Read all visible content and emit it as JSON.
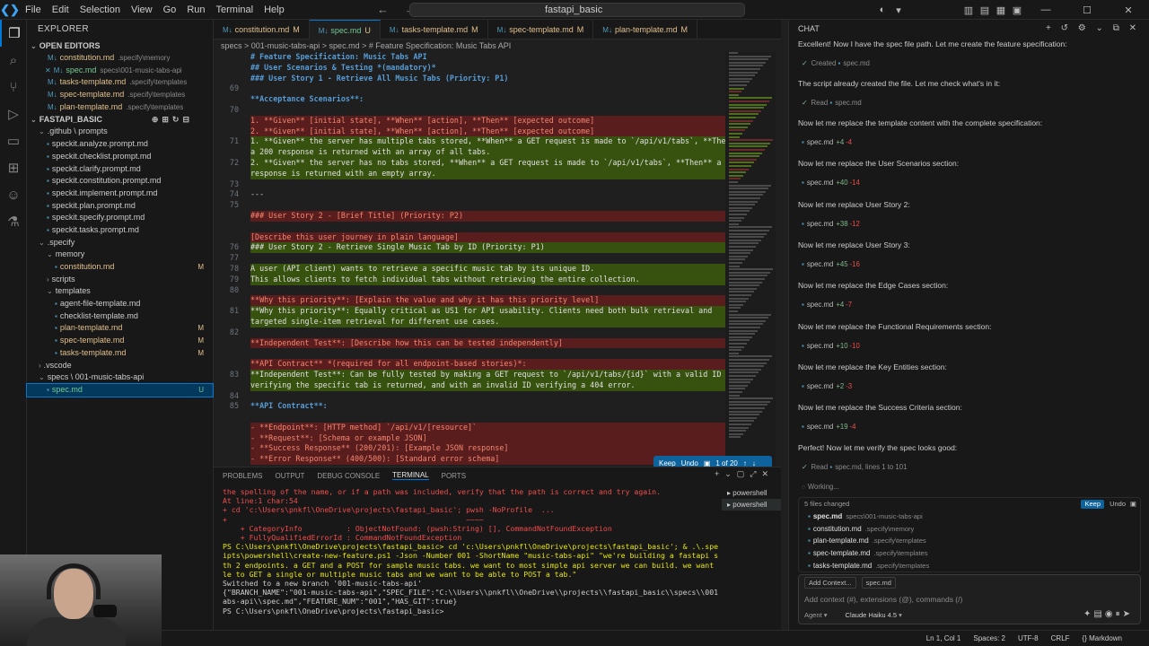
{
  "titlebar": {
    "menus": [
      "File",
      "Edit",
      "Selection",
      "View",
      "Go",
      "Run",
      "Terminal",
      "Help"
    ],
    "search": "fastapi_basic"
  },
  "sidebar": {
    "title": "EXPLORER",
    "open_editors_label": "OPEN EDITORS",
    "open_editors": [
      {
        "name": "constitution.md",
        "path": ".specify\\memory",
        "status": "M"
      },
      {
        "name": "spec.md",
        "path": "specs\\001-music-tabs-api",
        "status": "U",
        "closable": true
      },
      {
        "name": "tasks-template.md",
        "path": ".specify\\templates",
        "status": "M"
      },
      {
        "name": "spec-template.md",
        "path": ".specify\\templates",
        "status": "M"
      },
      {
        "name": "plan-template.md",
        "path": ".specify\\templates",
        "status": "M"
      }
    ],
    "project_label": "FASTAPI_BASIC",
    "tree": [
      {
        "name": ".github \\ prompts",
        "depth": 1,
        "folder": true
      },
      {
        "name": "speckit.analyze.prompt.md",
        "depth": 2
      },
      {
        "name": "speckit.checklist.prompt.md",
        "depth": 2
      },
      {
        "name": "speckit.clarify.prompt.md",
        "depth": 2
      },
      {
        "name": "speckit.constitution.prompt.md",
        "depth": 2
      },
      {
        "name": "speckit.implement.prompt.md",
        "depth": 2
      },
      {
        "name": "speckit.plan.prompt.md",
        "depth": 2
      },
      {
        "name": "speckit.specify.prompt.md",
        "depth": 2
      },
      {
        "name": "speckit.tasks.prompt.md",
        "depth": 2
      },
      {
        "name": ".specify",
        "depth": 1,
        "folder": true
      },
      {
        "name": "memory",
        "depth": 2,
        "folder": true
      },
      {
        "name": "constitution.md",
        "depth": 3,
        "status": "M"
      },
      {
        "name": "scripts",
        "depth": 2,
        "folder": true,
        "collapsed": true
      },
      {
        "name": "templates",
        "depth": 2,
        "folder": true
      },
      {
        "name": "agent-file-template.md",
        "depth": 3
      },
      {
        "name": "checklist-template.md",
        "depth": 3
      },
      {
        "name": "plan-template.md",
        "depth": 3,
        "status": "M"
      },
      {
        "name": "spec-template.md",
        "depth": 3,
        "status": "M"
      },
      {
        "name": "tasks-template.md",
        "depth": 3,
        "status": "M"
      },
      {
        "name": ".vscode",
        "depth": 1,
        "folder": true,
        "collapsed": true
      },
      {
        "name": "specs \\ 001-music-tabs-api",
        "depth": 1,
        "folder": true
      },
      {
        "name": "spec.md",
        "depth": 2,
        "status": "U",
        "selected": true
      }
    ]
  },
  "editor": {
    "tabs": [
      {
        "label": "constitution.md",
        "status": "M"
      },
      {
        "label": "spec.md",
        "status": "U",
        "active": true
      },
      {
        "label": "tasks-template.md",
        "status": "M"
      },
      {
        "label": "spec-template.md",
        "status": "M"
      },
      {
        "label": "plan-template.md",
        "status": "M"
      }
    ],
    "breadcrumb": "specs > 001-music-tabs-api > spec.md > # Feature Specification: Music Tabs API",
    "lines": [
      {
        "n": "",
        "t": "# Feature Specification: Music Tabs API",
        "k": "h"
      },
      {
        "n": "",
        "t": "## User Scenarios & Testing *(mandatory)*",
        "k": "h"
      },
      {
        "n": "",
        "t": "### User Story 1 - Retrieve All Music Tabs (Priority: P1)",
        "k": "h"
      },
      {
        "n": "69",
        "t": "",
        "k": ""
      },
      {
        "n": "",
        "t": "**Acceptance Scenarios**:",
        "k": "h"
      },
      {
        "n": "70",
        "t": "",
        "k": ""
      },
      {
        "n": "",
        "t": "1. **Given** [initial state], **When** [action], **Then** [expected outcome]",
        "k": "del"
      },
      {
        "n": "",
        "t": "2. **Given** [initial state], **When** [action], **Then** [expected outcome]",
        "k": "del"
      },
      {
        "n": "71",
        "t": "1. **Given** the server has multiple tabs stored, **When** a GET request is made to `/api/v1/tabs`, **Then**",
        "k": "add"
      },
      {
        "n": "",
        "t": "a 200 response is returned with an array of all tabs.",
        "k": "add"
      },
      {
        "n": "72",
        "t": "2. **Given** the server has no tabs stored, **When** a GET request is made to `/api/v1/tabs`, **Then** a 200",
        "k": "add"
      },
      {
        "n": "",
        "t": "response is returned with an empty array.",
        "k": "add"
      },
      {
        "n": "73",
        "t": "",
        "k": ""
      },
      {
        "n": "74",
        "t": "---",
        "k": ""
      },
      {
        "n": "75",
        "t": "",
        "k": ""
      },
      {
        "n": "",
        "t": "### User Story 2 - [Brief Title] (Priority: P2)",
        "k": "del"
      },
      {
        "n": "",
        "t": "",
        "k": "del"
      },
      {
        "n": "",
        "t": "[Describe this user journey in plain language]",
        "k": "del"
      },
      {
        "n": "76",
        "t": "### User Story 2 - Retrieve Single Music Tab by ID (Priority: P1)",
        "k": "add"
      },
      {
        "n": "77",
        "t": "",
        "k": "add"
      },
      {
        "n": "78",
        "t": "A user (API client) wants to retrieve a specific music tab by its unique ID.",
        "k": "add"
      },
      {
        "n": "79",
        "t": "This allows clients to fetch individual tabs without retrieving the entire collection.",
        "k": "add"
      },
      {
        "n": "80",
        "t": "",
        "k": ""
      },
      {
        "n": "",
        "t": "**Why this priority**: [Explain the value and why it has this priority level]",
        "k": "del"
      },
      {
        "n": "81",
        "t": "**Why this priority**: Equally critical as US1 for API usability. Clients need both bulk retrieval and",
        "k": "add"
      },
      {
        "n": "",
        "t": "targeted single-item retrieval for different use cases.",
        "k": "add"
      },
      {
        "n": "82",
        "t": "",
        "k": ""
      },
      {
        "n": "",
        "t": "**Independent Test**: [Describe how this can be tested independently]",
        "k": "del"
      },
      {
        "n": "",
        "t": "",
        "k": "del"
      },
      {
        "n": "",
        "t": "**API Contract** *(required for all endpoint-based stories)*:",
        "k": "del"
      },
      {
        "n": "83",
        "t": "**Independent Test**: Can be fully tested by making a GET request to `/api/v1/tabs/{id}` with a valid ID and",
        "k": "add"
      },
      {
        "n": "",
        "t": "verifying the specific tab is returned, and with an invalid ID verifying a 404 error.",
        "k": "add"
      },
      {
        "n": "84",
        "t": "",
        "k": ""
      },
      {
        "n": "85",
        "t": "**API Contract**:",
        "k": "h"
      },
      {
        "n": "",
        "t": "",
        "k": ""
      },
      {
        "n": "",
        "t": "- **Endpoint**: [HTTP method] `/api/v1/[resource]`",
        "k": "del"
      },
      {
        "n": "",
        "t": "- **Request**: [Schema or example JSON]",
        "k": "del"
      },
      {
        "n": "",
        "t": "- **Success Response** (200/201): [Example JSON response]",
        "k": "del"
      },
      {
        "n": "",
        "t": "- **Error Response** (400/500): [Standard error schema]",
        "k": "del"
      }
    ],
    "diff_bar": {
      "keep": "Keep",
      "undo": "Undo",
      "counter": "1 of 20"
    }
  },
  "panel": {
    "tabs": [
      "PROBLEMS",
      "OUTPUT",
      "DEBUG CONSOLE",
      "TERMINAL",
      "PORTS"
    ],
    "active_tab": "TERMINAL",
    "shells": [
      "powershell",
      "powershell"
    ],
    "terminal_lines": [
      {
        "t": "the spelling of the name, or if a path was included, verify that the path is correct and try again.",
        "c": "err"
      },
      {
        "t": "At line:1 char:54",
        "c": "err"
      },
      {
        "t": "+ cd 'c:\\Users\\pnkfl\\OneDrive\\projects\\fastapi_basic'; pwsh -NoProfile  ...",
        "c": "err"
      },
      {
        "t": "+                                                      ~~~~",
        "c": "err"
      },
      {
        "t": "    + CategoryInfo          : ObjectNotFound: (pwsh:String) [], CommandNotFoundException",
        "c": "err"
      },
      {
        "t": "    + FullyQualifiedErrorId : CommandNotFoundException",
        "c": "err"
      },
      {
        "t": "",
        "c": ""
      },
      {
        "t": "PS C:\\Users\\pnkfl\\OneDrive\\projects\\fastapi_basic> cd 'c:\\Users\\pnkfl\\OneDrive\\projects\\fastapi_basic'; & .\\.specify\\scr",
        "c": "cmd"
      },
      {
        "t": "ipts\\powershell\\create-new-feature.ps1 -Json -Number 001 -ShortName \"music-tabs-api\" \"we're building a fastapi server wi",
        "c": "cmd"
      },
      {
        "t": "th 2 endpoints. a GET and a POST for sample music tabs. we want to most simple api server we can build. we want to be ab",
        "c": "cmd"
      },
      {
        "t": "le to GET a single or multiple music tabs and we want to be able to POST a tab.\"",
        "c": "cmd"
      },
      {
        "t": "Switched to a new branch '001-music-tabs-api'",
        "c": ""
      },
      {
        "t": "{\"BRANCH_NAME\":\"001-music-tabs-api\",\"SPEC_FILE\":\"C:\\\\Users\\\\pnkfl\\\\OneDrive\\\\projects\\\\fastapi_basic\\\\specs\\\\001-music-t",
        "c": ""
      },
      {
        "t": "abs-api\\\\spec.md\",\"FEATURE_NUM\":\"001\",\"HAS_GIT\":true}",
        "c": ""
      },
      {
        "t": "PS C:\\Users\\pnkfl\\OneDrive\\projects\\fastapi_basic> ",
        "c": ""
      }
    ]
  },
  "chat": {
    "title": "CHAT",
    "messages": [
      {
        "type": "text",
        "t": "Excellent! Now I have the spec file path. Let me create the feature specification:"
      },
      {
        "type": "tool",
        "verb": "Created",
        "file": "spec.md"
      },
      {
        "type": "text",
        "t": "The script already created the file. Let me check what's in it:"
      },
      {
        "type": "tool",
        "verb": "Read",
        "file": "spec.md"
      },
      {
        "type": "text",
        "t": "Now let me replace the template content with the complete specification:"
      },
      {
        "type": "edit",
        "file": "spec.md",
        "plus": "+4",
        "minus": "-4"
      },
      {
        "type": "text",
        "t": "Now let me replace the User Scenarios section:"
      },
      {
        "type": "edit",
        "file": "spec.md",
        "plus": "+40",
        "minus": "-14"
      },
      {
        "type": "text",
        "t": "Now let me replace User Story 2:"
      },
      {
        "type": "edit",
        "file": "spec.md",
        "plus": "+38",
        "minus": "-12"
      },
      {
        "type": "text",
        "t": "Now let me replace User Story 3:"
      },
      {
        "type": "edit",
        "file": "spec.md",
        "plus": "+45",
        "minus": "-16"
      },
      {
        "type": "text",
        "t": "Now let me replace the Edge Cases section:"
      },
      {
        "type": "edit",
        "file": "spec.md",
        "plus": "+4",
        "minus": "-7"
      },
      {
        "type": "text",
        "t": "Now let me replace the Functional Requirements section:"
      },
      {
        "type": "edit",
        "file": "spec.md",
        "plus": "+10",
        "minus": "-10"
      },
      {
        "type": "text",
        "t": "Now let me replace the Key Entities section:"
      },
      {
        "type": "edit",
        "file": "spec.md",
        "plus": "+2",
        "minus": "-3"
      },
      {
        "type": "text",
        "t": "Now let me replace the Success Criteria section:"
      },
      {
        "type": "edit",
        "file": "spec.md",
        "plus": "+19",
        "minus": "-4"
      },
      {
        "type": "text",
        "t": "Perfect! Now let me verify the spec looks good:"
      },
      {
        "type": "tool",
        "verb": "Read",
        "file": "spec.md",
        "extra": ", lines 1 to 101"
      },
      {
        "type": "working",
        "t": "Working..."
      }
    ],
    "changes": {
      "header": "5 files changed",
      "keep": "Keep",
      "undo": "Undo",
      "files": [
        {
          "name": "spec.md",
          "dir": "specs\\001-music-tabs-api"
        },
        {
          "name": "constitution.md",
          "dir": ".specify\\memory"
        },
        {
          "name": "plan-template.md",
          "dir": ".specify\\templates"
        },
        {
          "name": "spec-template.md",
          "dir": ".specify\\templates"
        },
        {
          "name": "tasks-template.md",
          "dir": ".specify\\templates"
        }
      ]
    },
    "input": {
      "add_context": "Add Context...",
      "context_file": "spec.md",
      "placeholder": "Add context (#), extensions (@), commands (/)",
      "mode": "Agent",
      "model": "Claude Haiku 4.5"
    }
  },
  "status": {
    "items": [
      "Ln 1, Col 1",
      "Spaces: 2",
      "UTF-8",
      "CRLF",
      "{} Markdown"
    ]
  },
  "colors": {
    "accent": "#0078d4",
    "deleted_bg": "#5a1d1d",
    "added_bg": "#37520f",
    "modified": "#e2c08d",
    "untracked": "#73c991"
  }
}
